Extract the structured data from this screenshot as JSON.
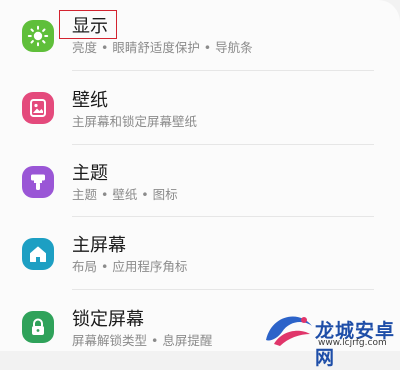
{
  "settings": [
    {
      "title": "显示",
      "subtitle": "亮度 • 眼睛舒适度保护 • 导航条",
      "icon": "sun-icon",
      "color": "#5fbf3a"
    },
    {
      "title": "壁纸",
      "subtitle": "主屏幕和锁定屏幕壁纸",
      "icon": "image-icon",
      "color": "#e44a7c"
    },
    {
      "title": "主题",
      "subtitle": "主题 • 壁纸 • 图标",
      "icon": "paint-brush-icon",
      "color": "#9a56d6"
    },
    {
      "title": "主屏幕",
      "subtitle": "布局 • 应用程序角标",
      "icon": "home-icon",
      "color": "#1d9fc3"
    },
    {
      "title": "锁定屏幕",
      "subtitle": "屏幕解锁类型 • 息屏提醒",
      "icon": "lock-icon",
      "color": "#2fa25a"
    }
  ],
  "watermark": {
    "name": "龙城安卓网",
    "url": "www.lcjrfg.com"
  }
}
